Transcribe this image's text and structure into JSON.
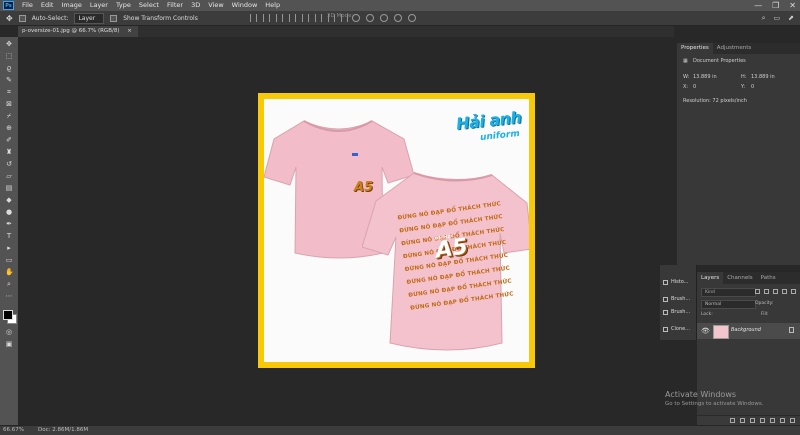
{
  "menu": {
    "logo": "Ps",
    "items": [
      "File",
      "Edit",
      "Image",
      "Layer",
      "Type",
      "Select",
      "Filter",
      "3D",
      "View",
      "Window",
      "Help"
    ],
    "window_controls": [
      "—",
      "❐",
      "✕"
    ]
  },
  "options": {
    "auto_select_label": "Auto-Select:",
    "auto_select_target": "Layer",
    "transform_label": "Show Transform Controls",
    "mode_3d_label": "3D Mode:",
    "right_icons": [
      "⌕",
      "▭",
      "⬈"
    ]
  },
  "document": {
    "tab_label": "p-oversize-01.jpg @ 66.7% (RGB/8)",
    "close": "×"
  },
  "artwork": {
    "logo_top": "Hải anh",
    "logo_bottom": "uniform",
    "front_emblem": "A5",
    "back_title": "A5",
    "back_sub": "ĐẠI HỌC",
    "back_lines": [
      "ĐỪNG NÓ ĐẠP ĐỔ THÁCH THỨC",
      "ĐỪNG NÓ ĐẠP ĐỔ THÁCH THỨC",
      "ĐỪNG NÓ ĐẠP ĐỔ THÁCH THỨC",
      "ĐỪNG NÓ ĐẠP ĐỔ THÁCH THỨC",
      "ĐỪNG NÓ ĐẠP ĐỔ THÁCH THỨC",
      "ĐỪNG NÓ ĐẠP ĐỔ THÁCH THỨC",
      "ĐỪNG NÓ ĐẠP ĐỔ THÁCH THỨC",
      "ĐỪNG NÓ ĐẠP ĐỔ THÁCH THỨC"
    ],
    "shirt_color": "#f2bcc8",
    "frame_color": "#f7c908"
  },
  "status": {
    "zoom": "66.67%",
    "doc_size": "Doc: 2.86M/1.86M"
  },
  "properties": {
    "tabs": [
      "Properties",
      "Adjustments"
    ],
    "heading": "Document Properties",
    "w_label": "W:",
    "w_value": "13.889 in",
    "h_label": "H:",
    "h_value": "13.889 in",
    "x_label": "X:",
    "x_value": "0",
    "y_label": "Y:",
    "y_value": "0",
    "resolution": "Resolution: 72 pixels/inch"
  },
  "mini_panel": {
    "items": [
      "Histo...",
      "Brush...",
      "Brush...",
      "Clone..."
    ]
  },
  "layers": {
    "tabs": [
      "Layers",
      "Channels",
      "Paths"
    ],
    "kind": "Kind",
    "blend": "Normal",
    "opacity": "Opacity:",
    "lock": "Lock:",
    "fill": "Fill:",
    "layer_name": "Background",
    "eye": "👁"
  },
  "watermark": {
    "title": "Activate Windows",
    "subtitle": "Go to Settings to activate Windows."
  }
}
